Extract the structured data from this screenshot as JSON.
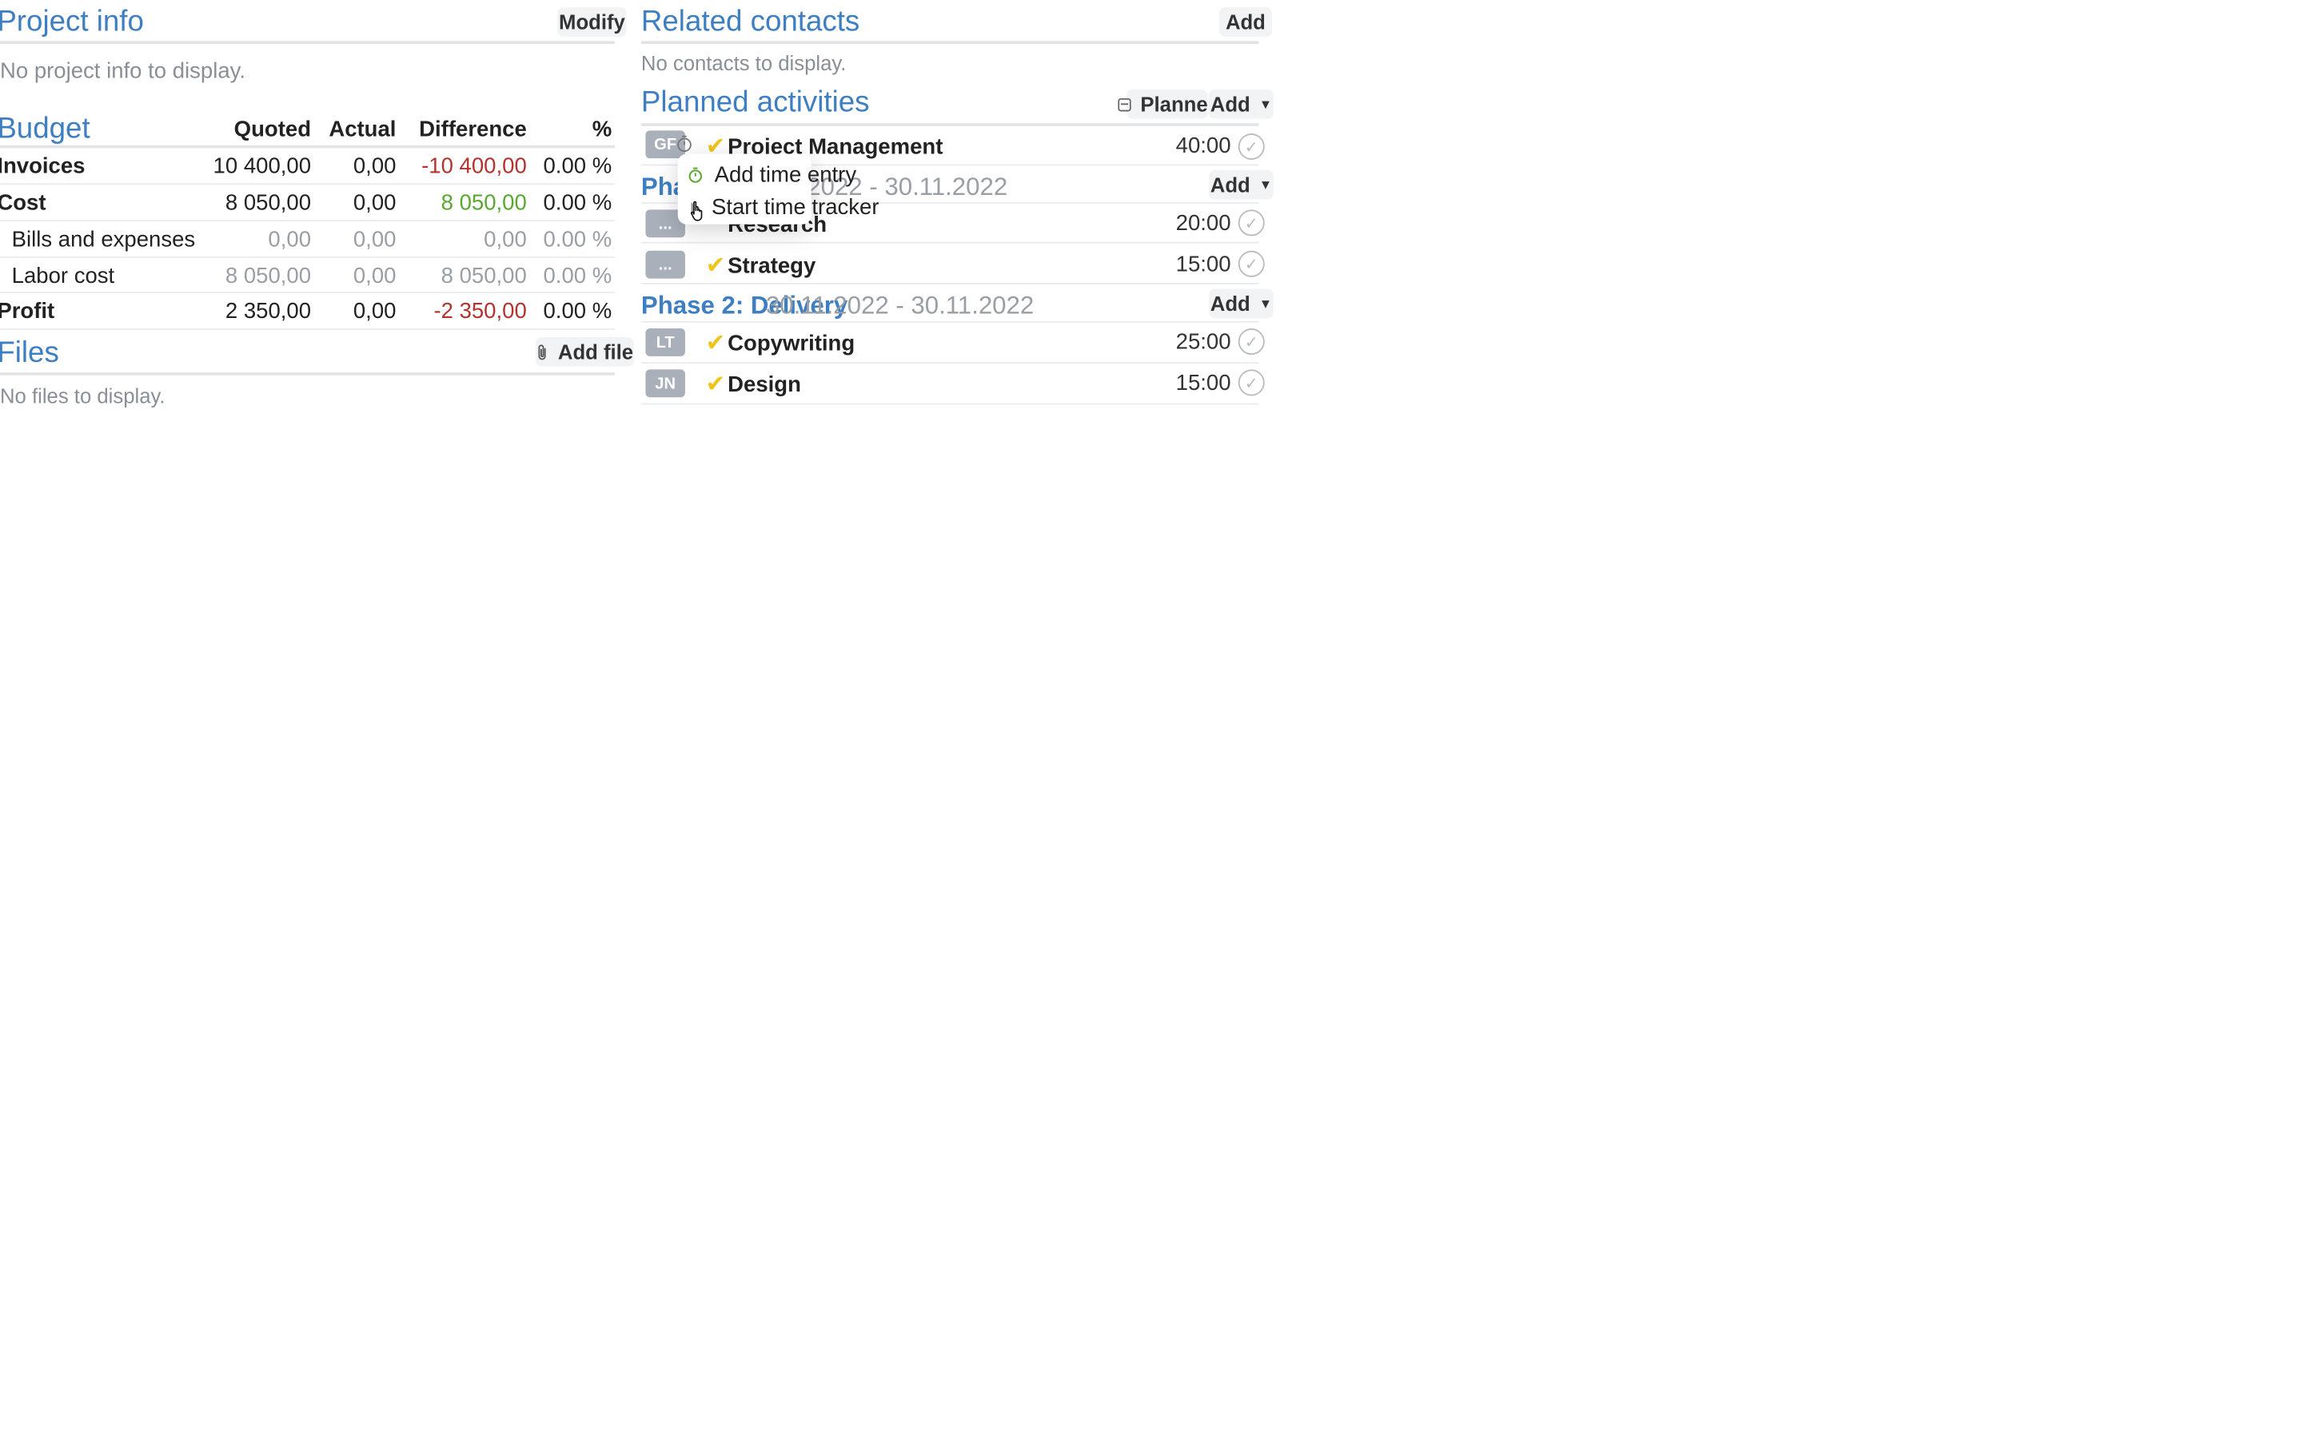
{
  "project_info": {
    "title": "Project info",
    "modify_label": "Modify",
    "empty_text": "No project info to display."
  },
  "budget": {
    "title": "Budget",
    "columns": [
      "Quoted",
      "Actual",
      "Difference",
      "%"
    ],
    "rows": [
      {
        "label": "Invoices",
        "quoted": "10 400,00",
        "actual": "0,00",
        "difference": "-10 400,00",
        "percent": "0.00 %"
      },
      {
        "label": "Cost",
        "quoted": "8 050,00",
        "actual": "0,00",
        "difference": "8 050,00",
        "percent": "0.00 %"
      },
      {
        "label": "Bills and expenses",
        "quoted": "0,00",
        "actual": "0,00",
        "difference": "0,00",
        "percent": "0.00 %"
      },
      {
        "label": "Labor cost",
        "quoted": "8 050,00",
        "actual": "0,00",
        "difference": "8 050,00",
        "percent": "0.00 %"
      },
      {
        "label": "Profit",
        "quoted": "2 350,00",
        "actual": "0,00",
        "difference": "-2 350,00",
        "percent": "0.00 %"
      }
    ],
    "colors": {
      "negative": "#b5332e",
      "positive": "#5aa832"
    }
  },
  "files": {
    "title": "Files",
    "add_file_label": "Add file",
    "empty_text": "No files to display."
  },
  "related_contacts": {
    "title": "Related contacts",
    "add_label": "Add",
    "empty_text": "No contacts to display."
  },
  "planned_activities": {
    "title": "Planned activities",
    "planner_label": "Planner",
    "add_label": "Add",
    "top_activity": {
      "tag": "GF",
      "name": "Project Management",
      "duration": "40:00"
    },
    "phases": [
      {
        "name": "Phase 1: Planning",
        "visible_name": "Phase",
        "dates": "30.11.2022 - 30.11.2022",
        "visible_dates": "2022 - 30.11.2022",
        "add_label": "Add",
        "activities": [
          {
            "tag": "...",
            "name": "Research",
            "duration": "20:00"
          },
          {
            "tag": "...",
            "name": "Strategy",
            "duration": "15:00"
          }
        ]
      },
      {
        "name": "Phase 2: Delivery",
        "dates": "30.11.2022 - 30.11.2022",
        "add_label": "Add",
        "activities": [
          {
            "tag": "LT",
            "name": "Copywriting",
            "duration": "25:00"
          },
          {
            "tag": "JN",
            "name": "Design",
            "duration": "15:00"
          }
        ]
      }
    ]
  },
  "context_menu": {
    "items": [
      "Add time entry",
      "Start time tracker"
    ]
  },
  "colors": {
    "accent": "#3d7fc2",
    "check": "#f0c419",
    "tag_bg": "#a9b0ba"
  },
  "icons": [
    "stopwatch-icon",
    "paperclip-icon",
    "calendar-icon",
    "play-icon",
    "check-icon",
    "hand-cursor-icon"
  ]
}
